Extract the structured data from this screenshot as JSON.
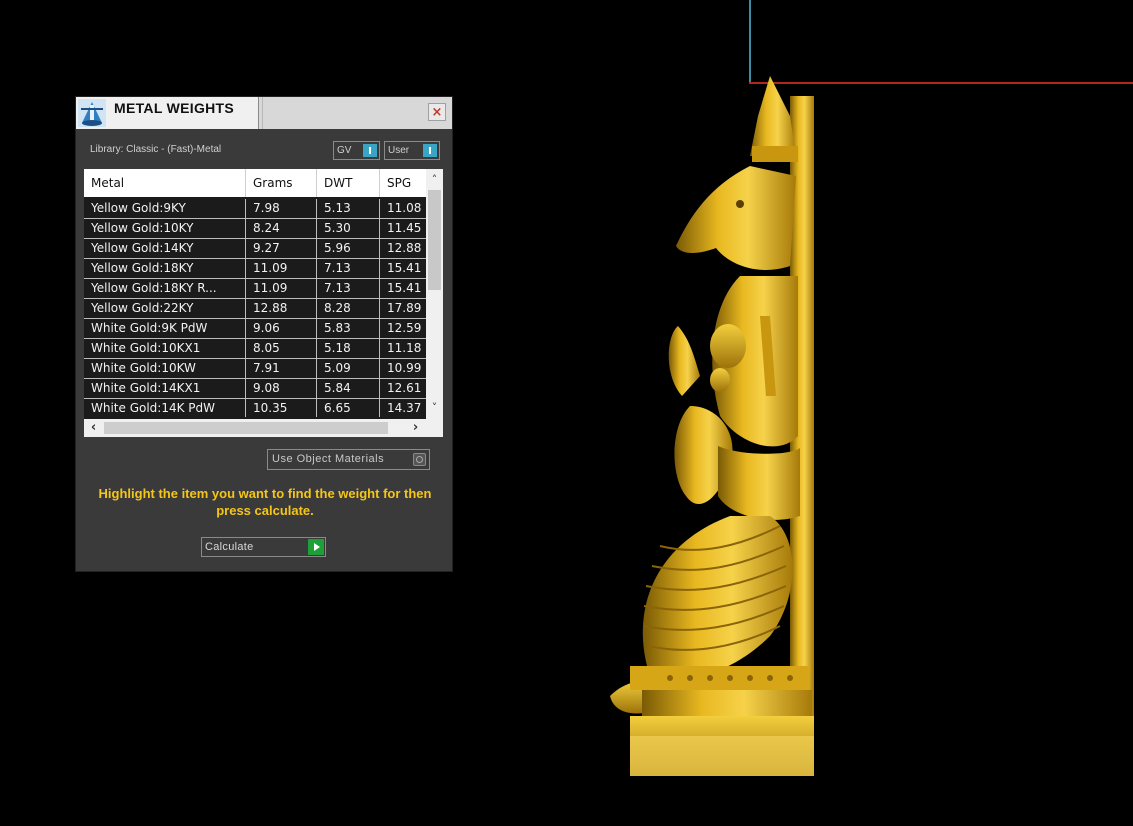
{
  "dialog": {
    "title": "METAL WEIGHTS",
    "close_label": "×",
    "library_label": "Library: Classic - (Fast)-Metal",
    "toggle_gv": "GV",
    "toggle_user": "User",
    "use_object_materials": "Use Object Materials",
    "instruction": "Highlight the item you want to find the weight for then press calculate.",
    "calculate_label": "Calculate"
  },
  "table": {
    "headers": [
      "Metal",
      "Grams",
      "DWT",
      "SPG"
    ],
    "rows": [
      [
        "Yellow Gold:9KY",
        "7.98",
        "5.13",
        "11.08"
      ],
      [
        "Yellow Gold:10KY",
        "8.24",
        "5.30",
        "11.45"
      ],
      [
        "Yellow Gold:14KY",
        "9.27",
        "5.96",
        "12.88"
      ],
      [
        "Yellow Gold:18KY",
        "11.09",
        "7.13",
        "15.41"
      ],
      [
        "Yellow Gold:18KY R...",
        "11.09",
        "7.13",
        "15.41"
      ],
      [
        "Yellow Gold:22KY",
        "12.88",
        "8.28",
        "17.89"
      ],
      [
        "White Gold:9K PdW",
        "9.06",
        "5.83",
        "12.59"
      ],
      [
        "White Gold:10KX1",
        "8.05",
        "5.18",
        "11.18"
      ],
      [
        "White Gold:10KW",
        "7.91",
        "5.09",
        "10.99"
      ],
      [
        "White Gold:14KX1",
        "9.08",
        "5.84",
        "12.61"
      ],
      [
        "White Gold:14K PdW",
        "10.35",
        "6.65",
        "14.37"
      ]
    ]
  },
  "colors": {
    "instruction_text": "#f5c518",
    "toggle_knob": "#3aa4c4",
    "calculate_go": "#1fa037",
    "model_gold": "#e0b020"
  },
  "icons": {
    "app": "scale-icon",
    "close": "close-icon",
    "scroll_up": "chevron-up-icon",
    "scroll_down": "chevron-down-icon",
    "scroll_left": "chevron-left-icon",
    "scroll_right": "chevron-right-icon",
    "calculate": "play-icon"
  }
}
